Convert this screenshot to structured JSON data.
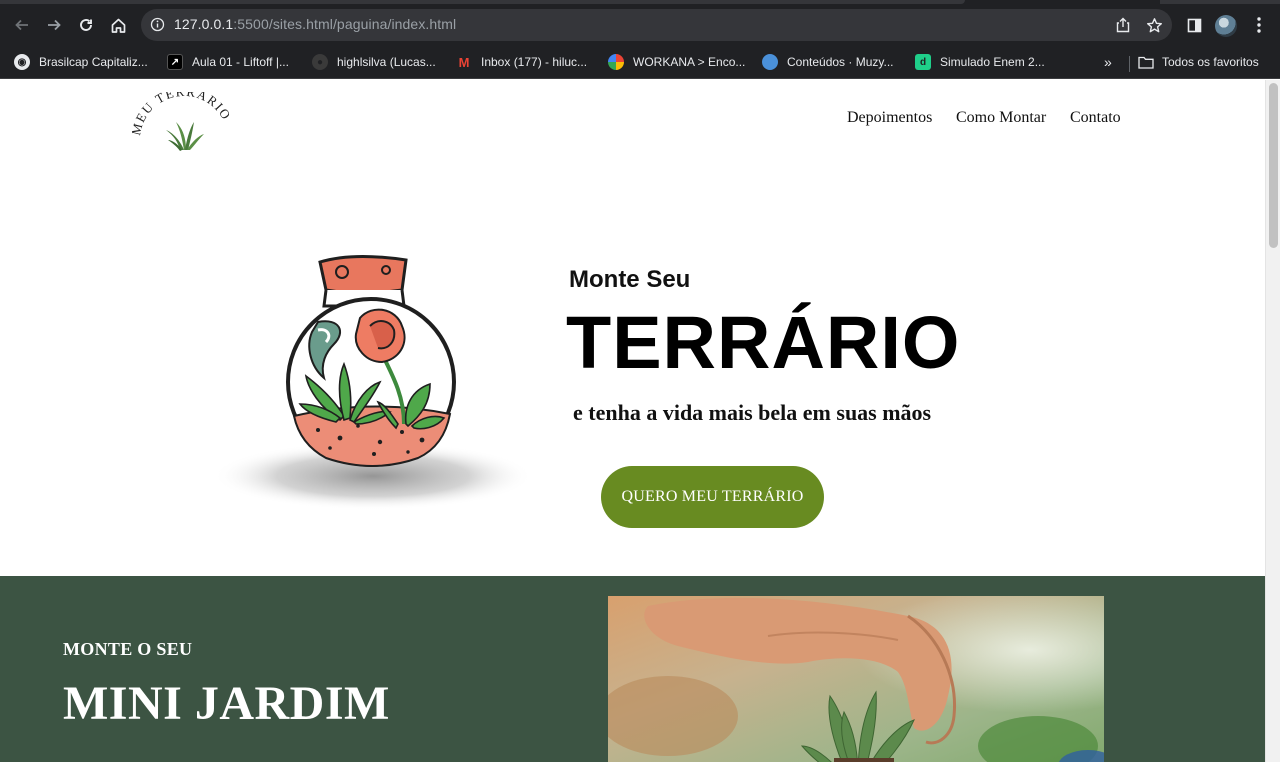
{
  "browser": {
    "url_host": "127.0.0.1",
    "url_rest": ":5500/sites.html/paguina/index.html",
    "bookmarks": [
      {
        "label": "Brasilcap Capitaliz..."
      },
      {
        "label": "Aula 01 - Liftoff |..."
      },
      {
        "label": "highlsilva (Lucas..."
      },
      {
        "label": "Inbox (177) - hiluc..."
      },
      {
        "label": "WORKANA > Enco..."
      },
      {
        "label": "Conteúdos · Muzy..."
      },
      {
        "label": "Simulado Enem 2..."
      }
    ],
    "more_label": "»",
    "all_bookmarks_label": "Todos os favoritos"
  },
  "site": {
    "logo_text": "MEU TERRÁRIO",
    "nav": [
      "Depoimentos",
      "Como Montar",
      "Contato"
    ],
    "hero": {
      "kicker": "Monte Seu",
      "title": "TERRÁRIO",
      "subtitle": "e tenha a vida mais bela em suas mãos",
      "cta": "QUERO MEU TERRÁRIO"
    },
    "section2": {
      "kicker": "MONTE O SEU",
      "title": "MINI JARDIM"
    }
  },
  "colors": {
    "cta_bg": "#688b21",
    "section_bg": "#3c5443",
    "chrome_bg": "#202124"
  }
}
